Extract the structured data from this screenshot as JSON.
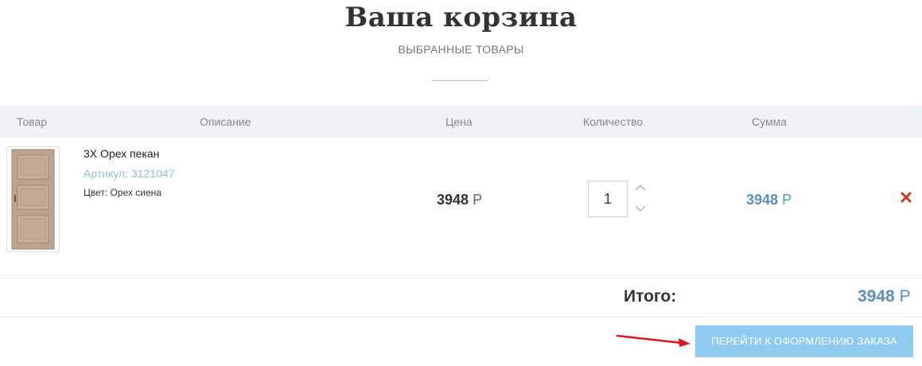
{
  "header": {
    "title": "Ваша корзина",
    "subtitle": "ВЫБРАННЫЕ ТОВАРЫ"
  },
  "table": {
    "columns": [
      "Товар",
      "Описание",
      "Цена",
      "Количество",
      "Сумма"
    ]
  },
  "item": {
    "image": "door-image",
    "name": "3X Орех пекан",
    "sku": "Артикул: 3121047",
    "color": "Цвет: Орех сиена",
    "price": "3948",
    "price_currency": "Р",
    "quantity": "1",
    "sum": "3948",
    "sum_currency": "Р",
    "remove_icon": "close-icon"
  },
  "total": {
    "label": "Итого:",
    "value": "3948",
    "currency": "Р"
  },
  "checkout": {
    "label": "ПЕРЕЙТИ К ОФОРМЛЕНИЮ ЗАКАЗА"
  },
  "colors": {
    "accent": "#5b8fb9",
    "sku": "#8ebfe2",
    "button": "#8fcaf0",
    "remove": "#c0392b",
    "annotation_arrow": "#e0161e"
  }
}
